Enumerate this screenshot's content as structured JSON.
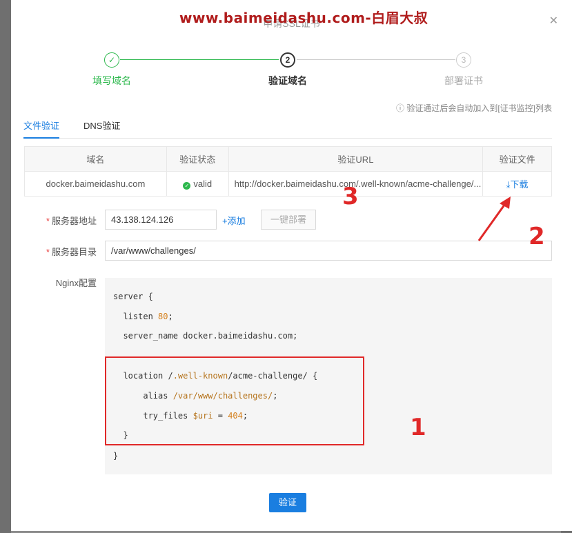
{
  "watermark": "www.baimeidashu.com-白眉大叔",
  "dialog": {
    "title": "申请SSL证书",
    "close_icon": "close-icon"
  },
  "steps": [
    {
      "label": "填写域名",
      "marker": "✓",
      "state": "done"
    },
    {
      "label": "验证域名",
      "marker": "2",
      "state": "active"
    },
    {
      "label": "部署证书",
      "marker": "3",
      "state": "todo"
    }
  ],
  "tip": "ⓘ 验证通过后会自动加入到[证书监控]列表",
  "tabs": [
    {
      "label": "文件验证",
      "active": true
    },
    {
      "label": "DNS验证",
      "active": false
    }
  ],
  "table": {
    "headers": [
      "域名",
      "验证状态",
      "验证URL",
      "验证文件"
    ],
    "row": {
      "domain": "docker.baimeidashu.com",
      "status": "valid",
      "url": "http://docker.baimeidashu.com/.well-known/acme-challenge/...",
      "file_action": "下载",
      "file_icon": "download-icon"
    }
  },
  "form": {
    "server_addr_label": "服务器地址",
    "server_addr_value": "43.138.124.126",
    "add_label": "+添加",
    "deploy_label": "一键部署",
    "server_dir_label": "服务器目录",
    "server_dir_value": "/var/www/challenges/",
    "nginx_label": "Nginx配置"
  },
  "nginx_config": {
    "l1": "server {",
    "l2a": "  listen ",
    "l2b": "80",
    "l2c": ";",
    "l3": "  server_name docker.baimeidashu.com;",
    "l4a": "  location /",
    "l4b": ".well-known",
    "l4c": "/acme-challenge/ {",
    "l5a": "      alias ",
    "l5b": "/var/www/challenges/",
    "l5c": ";",
    "l6a": "      try_files ",
    "l6b": "$uri",
    "l6c": " = ",
    "l6d": "404",
    "l6e": ";",
    "l7": "  }",
    "l8": "}"
  },
  "annotations": {
    "one": "1",
    "two": "2",
    "three": "3"
  },
  "verify_button": "验证",
  "colors": {
    "accent": "#1a7ee0",
    "success": "#2db84d",
    "annotation": "#e02828"
  }
}
